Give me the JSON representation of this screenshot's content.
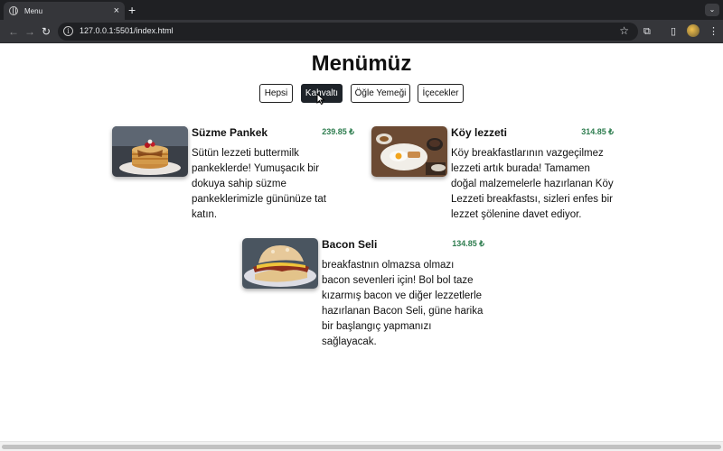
{
  "browser": {
    "tab_title": "Menu",
    "new_tab_label": "+",
    "close_label": "×",
    "url": "127.0.0.1:5501/index.html"
  },
  "page": {
    "title": "Menümüz"
  },
  "filters": [
    {
      "label": "Hepsi",
      "active": false
    },
    {
      "label": "Kahvaltı",
      "active": true
    },
    {
      "label": "Öğle Yemeği",
      "active": false
    },
    {
      "label": "İçecekler",
      "active": false
    }
  ],
  "menu_items": [
    {
      "name": "Süzme Pankek",
      "price": "239.85 ₺",
      "description": "Sütün lezzeti buttermilk pankeklerde! Yumuşacık bir dokuya sahip süzme pankeklerimizle gününüze tat katın.",
      "image": "pancake-photo"
    },
    {
      "name": "Köy lezzeti",
      "price": "314.85 ₺",
      "description": "Köy breakfastlarının vazgeçilmez lezzeti artık burada! Tamamen doğal malzemelerle hazırlanan Köy Lezzeti breakfastsı, sizleri enfes bir lezzet şölenine davet ediyor.",
      "image": "village-breakfast-photo"
    },
    {
      "name": "Bacon Seli",
      "price": "134.85 ₺",
      "description": "breakfastnın olmazsa olmazı bacon sevenleri için! Bol bol taze kızarmış bacon ve diğer lezzetlerle hazırlanan Bacon Seli, güne harika bir başlangıç yapmanızı sağlayacak.",
      "image": "bacon-sandwich-photo"
    }
  ],
  "colors": {
    "active_filter": "#1e2329",
    "price": "#2e7d4f"
  }
}
